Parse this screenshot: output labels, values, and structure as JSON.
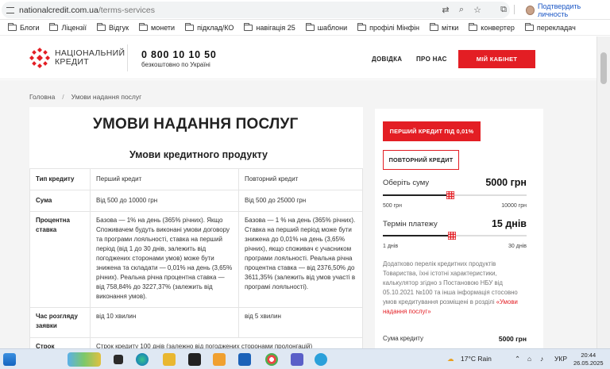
{
  "browser": {
    "url_domain": "nationalcredit.com.ua",
    "url_path": "/terms-services",
    "profile_label": "Подтвердить личность",
    "bookmarks": [
      "Блоги",
      "Ліцензії",
      "Відгук",
      "монети",
      "підклад/КО",
      "навігація 25",
      "шаблони",
      "профілі Мінфін",
      "мітки",
      "конвертер",
      "перекладач"
    ]
  },
  "header": {
    "logo_line1": "НАЦІОНАЛЬНИЙ",
    "logo_line2": "КРЕДИТ",
    "phone": "0 800 10 10 50",
    "phone_sub": "безкоштовно по Україні",
    "nav": [
      "ДОВІДКА",
      "ПРО НАС"
    ],
    "cabinet_button": "МІЙ КАБІНЕТ",
    "brand_color": "#e31e24"
  },
  "breadcrumb": {
    "home": "Головна",
    "separator": "/",
    "current": "Умови надання послуг"
  },
  "main": {
    "title": "УМОВИ НАДАННЯ ПОСЛУГ",
    "subtitle": "Умови кредитного продукту",
    "table": [
      {
        "label": "Тип кредиту",
        "first": "Перший кредит",
        "repeat": "Повторний кредит"
      },
      {
        "label": "Сума",
        "first": "Від 500 до 10000 грн",
        "repeat": "Від 500 до 25000 грн"
      },
      {
        "label": "Процентна ставка",
        "first": "Базова — 1% на день (365% річних). Якщо Споживачем будуть виконані умови договору та програми лояльності, ставка на перший період (від 1 до 30 днів, залежить від погоджених сторонами умов) може бути знижена та складати — 0,01% на день (3,65% річних). Реальна річна процентна ставка — від 758,84% до 3227,37% (залежить від виконання умов).",
        "repeat": "Базова — 1 % на день (365% річних). Ставка на перший період може бути знижена до 0,01% на день (3,65% річних), якщо споживач є учасником програми лояльності. Реальна річна процентна ставка — від 2376,50% до 3611,35% (залежить від умов участі в програмі лояльності)."
      },
      {
        "label": "Час розгляду заявки",
        "first": "від 10 хвилин",
        "repeat": "від 5 хвилин"
      },
      {
        "label": "Строк",
        "first": "Строк кредиту 100 днів (залежно від погоджених сторонами пролонгацій)",
        "repeat": ""
      }
    ]
  },
  "sidebar": {
    "first_credit_button": "ПЕРШИЙ КРЕДИТ ПІД 0,01%",
    "repeat_credit_button": "ПОВТОРНИЙ КРЕДИТ",
    "amount_label": "Оберіть суму",
    "amount_value": "5000 грн",
    "amount_min": "500 грн",
    "amount_max": "10000 грн",
    "amount_fraction": 0.47,
    "term_label": "Термін платежу",
    "term_value": "15 днів",
    "term_min": "1 днів",
    "term_max": "30 днів",
    "term_fraction": 0.48,
    "info_text": "Додатково перелік кредитних продуктів Товариства, їхні істотні характеристики, калькулятор згідно з Постановою НБУ від 05.10.2021 №100 та інша інформація стосовно умов кредитування розміщені в розділі ",
    "info_link": "«Умови надання послуг»",
    "sum_label": "Сума кредиту",
    "sum_value": "5000 грн"
  },
  "taskbar": {
    "weather": "17°C  Rain",
    "language": "УКР",
    "time": "20:44",
    "date": "26.05.2025"
  }
}
